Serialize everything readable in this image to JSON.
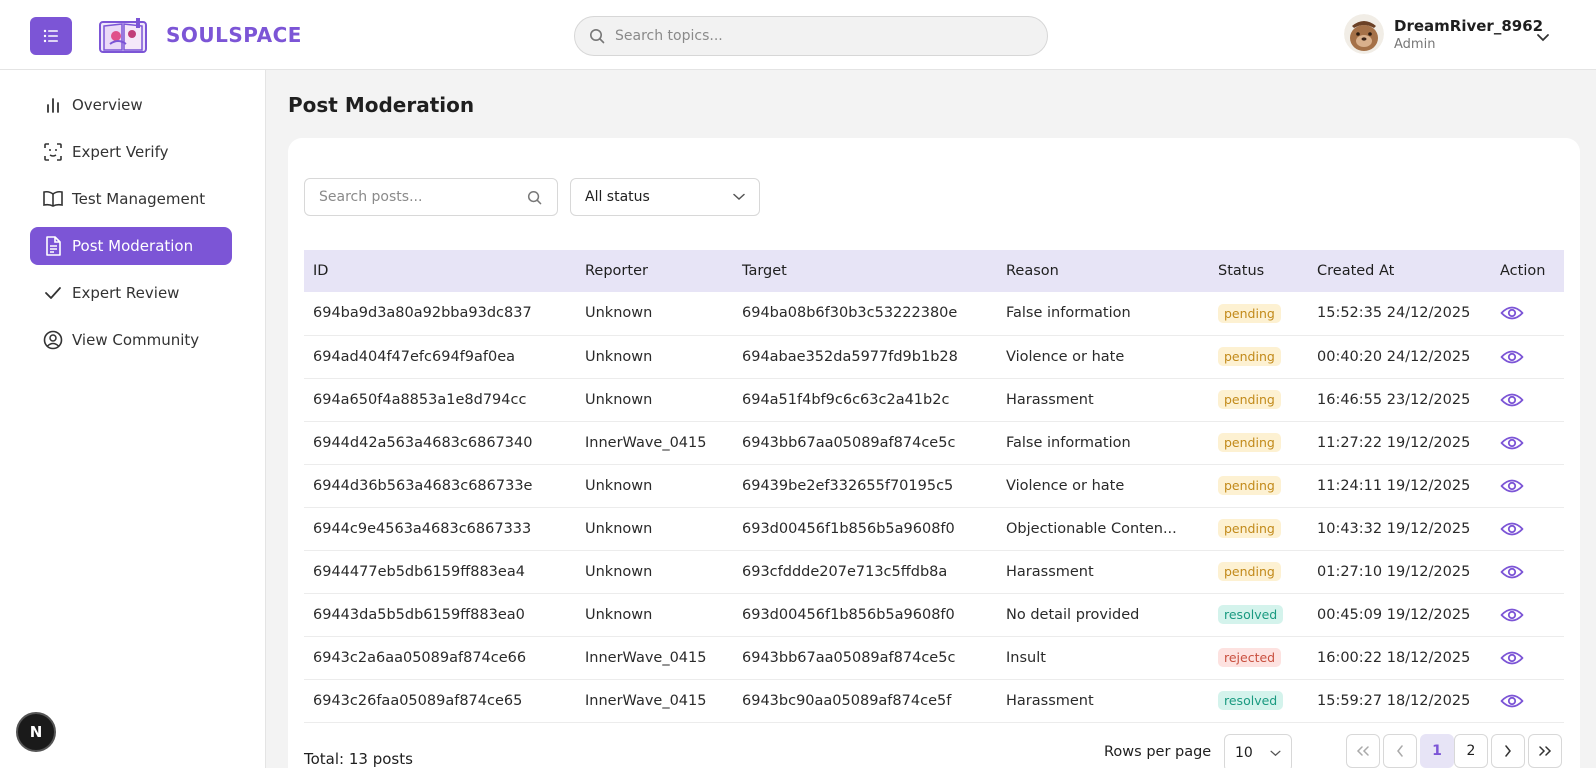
{
  "header": {
    "brand": "SOULSPACE",
    "search_placeholder": "Search topics...",
    "user_name": "DreamRiver_8962",
    "user_role": "Admin"
  },
  "sidebar": {
    "items": [
      {
        "label": "Overview",
        "icon": "bar-chart-icon"
      },
      {
        "label": "Expert Verify",
        "icon": "face-scan-icon"
      },
      {
        "label": "Test Management",
        "icon": "book-icon"
      },
      {
        "label": "Post Moderation",
        "icon": "document-icon",
        "active": true
      },
      {
        "label": "Expert Review",
        "icon": "check-icon"
      },
      {
        "label": "View Community",
        "icon": "user-circle-icon"
      }
    ]
  },
  "main": {
    "title": "Post Moderation",
    "search_placeholder": "Search posts...",
    "status_filter": "All status",
    "columns": [
      "ID",
      "Reporter",
      "Target",
      "Reason",
      "Status",
      "Created At",
      "Action"
    ],
    "rows": [
      {
        "id": "694ba9d3a80a92bba93dc837",
        "reporter": "Unknown",
        "target": "694ba08b6f30b3c53222380e",
        "reason": "False information",
        "status": "pending",
        "created": "15:52:35 24/12/2025"
      },
      {
        "id": "694ad404f47efc694f9af0ea",
        "reporter": "Unknown",
        "target": "694abae352da5977fd9b1b28",
        "reason": "Violence or hate",
        "status": "pending",
        "created": "00:40:20 24/12/2025"
      },
      {
        "id": "694a650f4a8853a1e8d794cc",
        "reporter": "Unknown",
        "target": "694a51f4bf9c6c63c2a41b2c",
        "reason": "Harassment",
        "status": "pending",
        "created": "16:46:55 23/12/2025"
      },
      {
        "id": "6944d42a563a4683c6867340",
        "reporter": "InnerWave_0415",
        "target": "6943bb67aa05089af874ce5c",
        "reason": "False information",
        "status": "pending",
        "created": "11:27:22 19/12/2025"
      },
      {
        "id": "6944d36b563a4683c686733e",
        "reporter": "Unknown",
        "target": "69439be2ef332655f70195c5",
        "reason": "Violence or hate",
        "status": "pending",
        "created": "11:24:11 19/12/2025"
      },
      {
        "id": "6944c9e4563a4683c6867333",
        "reporter": "Unknown",
        "target": "693d00456f1b856b5a9608f0",
        "reason": "Objectionable Conten...",
        "status": "pending",
        "created": "10:43:32 19/12/2025"
      },
      {
        "id": "6944477eb5db6159ff883ea4",
        "reporter": "Unknown",
        "target": "693cfddde207e713c5ffdb8a",
        "reason": "Harassment",
        "status": "pending",
        "created": "01:27:10 19/12/2025"
      },
      {
        "id": "69443da5b5db6159ff883ea0",
        "reporter": "Unknown",
        "target": "693d00456f1b856b5a9608f0",
        "reason": "No detail provided",
        "status": "resolved",
        "created": "00:45:09 19/12/2025"
      },
      {
        "id": "6943c2a6aa05089af874ce66",
        "reporter": "InnerWave_0415",
        "target": "6943bb67aa05089af874ce5c",
        "reason": "Insult",
        "status": "rejected",
        "created": "16:00:22 18/12/2025"
      },
      {
        "id": "6943c26faa05089af874ce65",
        "reporter": "InnerWave_0415",
        "target": "6943bc90aa05089af874ce5f",
        "reason": "Harassment",
        "status": "resolved",
        "created": "15:59:27 18/12/2025"
      }
    ],
    "status_colors": {
      "pending": {
        "bg": "#fdf1d2",
        "fg": "#c28a1a"
      },
      "resolved": {
        "bg": "#d4f3ec",
        "fg": "#1a9a80"
      },
      "rejected": {
        "bg": "#fde2e0",
        "fg": "#c9503f"
      }
    },
    "total": "Total: 13 posts",
    "rows_per_page_label": "Rows per page",
    "rows_per_page": "10",
    "pages": [
      "1",
      "2"
    ],
    "current_page": "1"
  },
  "accent": "#7c55d6",
  "dev_badge": "N"
}
